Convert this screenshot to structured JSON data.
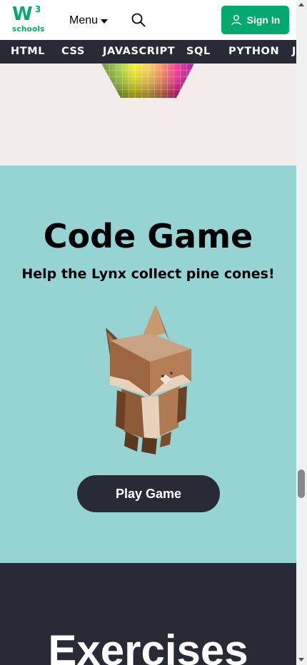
{
  "header": {
    "logo_text": "W",
    "logo_superscript": "3",
    "logo_subtext": "schools",
    "menu_label": "Menu",
    "signin_label": "Sign In"
  },
  "nav": [
    "HTML",
    "CSS",
    "JAVASCRIPT",
    "SQL",
    "PYTHON",
    "J"
  ],
  "game": {
    "title": "Code Game",
    "subtitle": "Help the Lynx collect pine cones!",
    "button": "Play Game"
  },
  "exercises": {
    "title": "Exercises"
  },
  "colors": {
    "brand_green": "#04AA6D",
    "nav_dark": "#282A35",
    "game_bg": "#96D4D4",
    "pink_bg": "#F3ECEA"
  },
  "icons": [
    "w3schools-logo",
    "chevron-down-icon",
    "search-icon",
    "user-icon",
    "lynx-illustration"
  ]
}
